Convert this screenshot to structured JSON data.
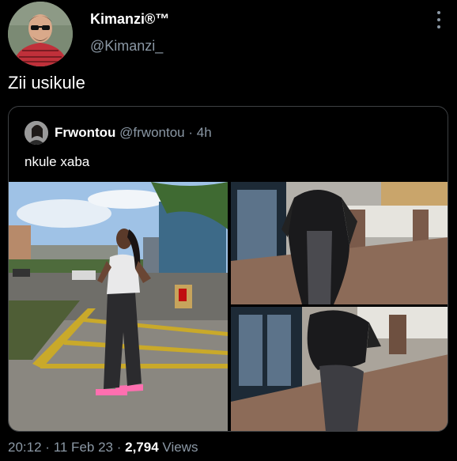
{
  "author": {
    "display_name": "Kimanzi®™",
    "handle": "@Kimanzi_"
  },
  "tweet": {
    "text": "Zii usikule"
  },
  "quoted_tweet": {
    "display_name": "Frwontou",
    "handle": "@frwontou",
    "separator": "·",
    "time_ago": "4h",
    "text": "nkule xaba",
    "media_count": 3
  },
  "footer": {
    "time": "20:12",
    "dot1": "·",
    "date": "11 Feb 23",
    "dot2": "·",
    "views_count": "2,794",
    "views_label": "Views"
  },
  "icons": {
    "more": "more-vertical-icon"
  },
  "colors": {
    "background": "#000000",
    "primary_text": "#e7e9ea",
    "secondary_text": "#8b98a5",
    "border": "#3e4144"
  }
}
